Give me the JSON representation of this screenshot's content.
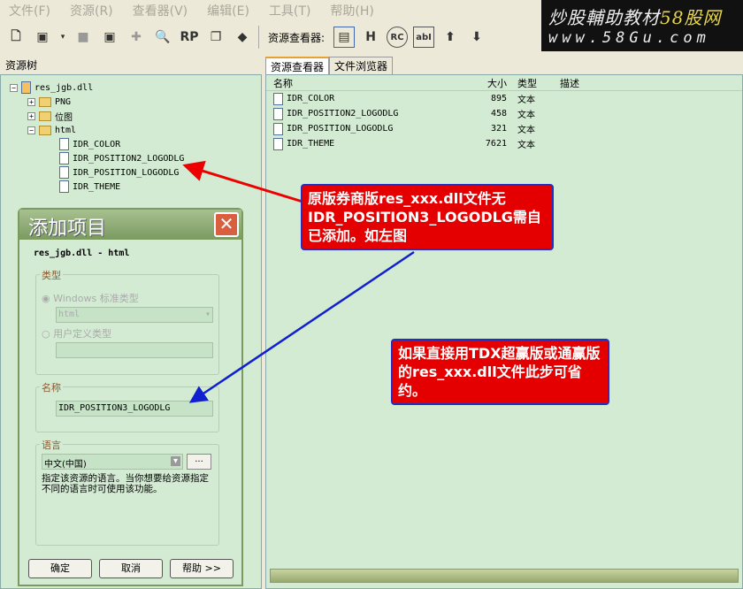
{
  "menu": [
    "文件(F)",
    "资源(R)",
    "查看器(V)",
    "编辑(E)",
    "工具(T)",
    "帮助(H)"
  ],
  "logo": {
    "line1": "炒股輔助教材",
    "line1b": "58股网",
    "line2": "www.58Gu.com"
  },
  "toolbar": {
    "viewer_label": "资源查看器:"
  },
  "left_header": "资源树",
  "tabs": [
    "资源查看器",
    "文件浏览器"
  ],
  "tree": {
    "root": "res_jgb.dll",
    "folders": [
      "PNG",
      "位图",
      "html"
    ],
    "items": [
      "IDR_COLOR",
      "IDR_POSITION2_LOGODLG",
      "IDR_POSITION_LOGODLG",
      "IDR_THEME"
    ]
  },
  "list": {
    "headers": [
      "名称",
      "大小",
      "类型",
      "描述"
    ],
    "rows": [
      [
        "IDR_COLOR",
        "895",
        "文本"
      ],
      [
        "IDR_POSITION2_LOGODLG",
        "458",
        "文本"
      ],
      [
        "IDR_POSITION_LOGODLG",
        "321",
        "文本"
      ],
      [
        "IDR_THEME",
        "7621",
        "文本"
      ]
    ]
  },
  "dialog": {
    "title": "添加项目",
    "subtitle": "res_jgb.dll - html",
    "type_group": "类型",
    "radio_standard": "Windows 标准类型",
    "standard_value": "html",
    "radio_custom": "用户定义类型",
    "name_group": "名称",
    "name_value": "IDR_POSITION3_LOGODLG",
    "lang_group": "语言",
    "lang_value": "中文(中国)",
    "lang_more": "...",
    "lang_desc": "指定该资源的语言。当你想要给资源指定不同的语言时可使用该功能。",
    "ok": "确定",
    "cancel": "取消",
    "help": "帮助 >>"
  },
  "callouts": [
    "原版券商版res_xxx.dll文件无IDR_POSITION3_LOGODLG需自已添加。如左图",
    "如果直接用TDX超赢版或通赢版的res_xxx.dll文件此步可省约。"
  ]
}
